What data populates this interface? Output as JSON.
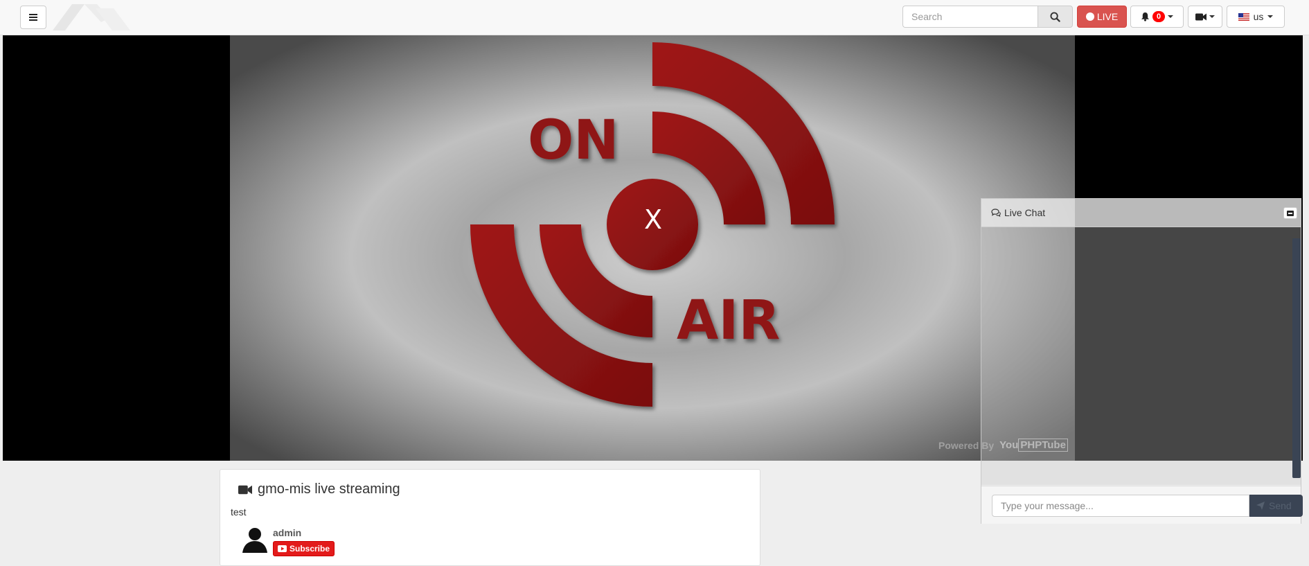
{
  "navbar": {
    "menu_icon": "hamburger-icon",
    "logo_icon": "site-logo",
    "search": {
      "placeholder": "Search",
      "value": "",
      "icon": "search-icon"
    },
    "live_label": "LIVE",
    "notifications": {
      "count": "0",
      "icon": "bell-icon"
    },
    "video_menu_icon": "video-camera-icon",
    "language": {
      "label": "us",
      "flag_icon": "us-flag-icon"
    }
  },
  "player": {
    "close_label": "X",
    "powered_by": "Powered By",
    "brand_you": "You",
    "brand_php": "PHPTube"
  },
  "video": {
    "title": "gmo-mis live streaming",
    "description": "test",
    "owner": "admin",
    "subscribe_label": "Subscribe"
  },
  "chat": {
    "title": "Live Chat",
    "input_placeholder": "Type your message...",
    "send_label": "Send"
  },
  "colors": {
    "live_red": "#d9534f",
    "badge_red": "#ff0000",
    "subscribe_red": "#e31b1b",
    "on_air_red": "#a31b1b",
    "chat_dark": "#3a4454"
  }
}
